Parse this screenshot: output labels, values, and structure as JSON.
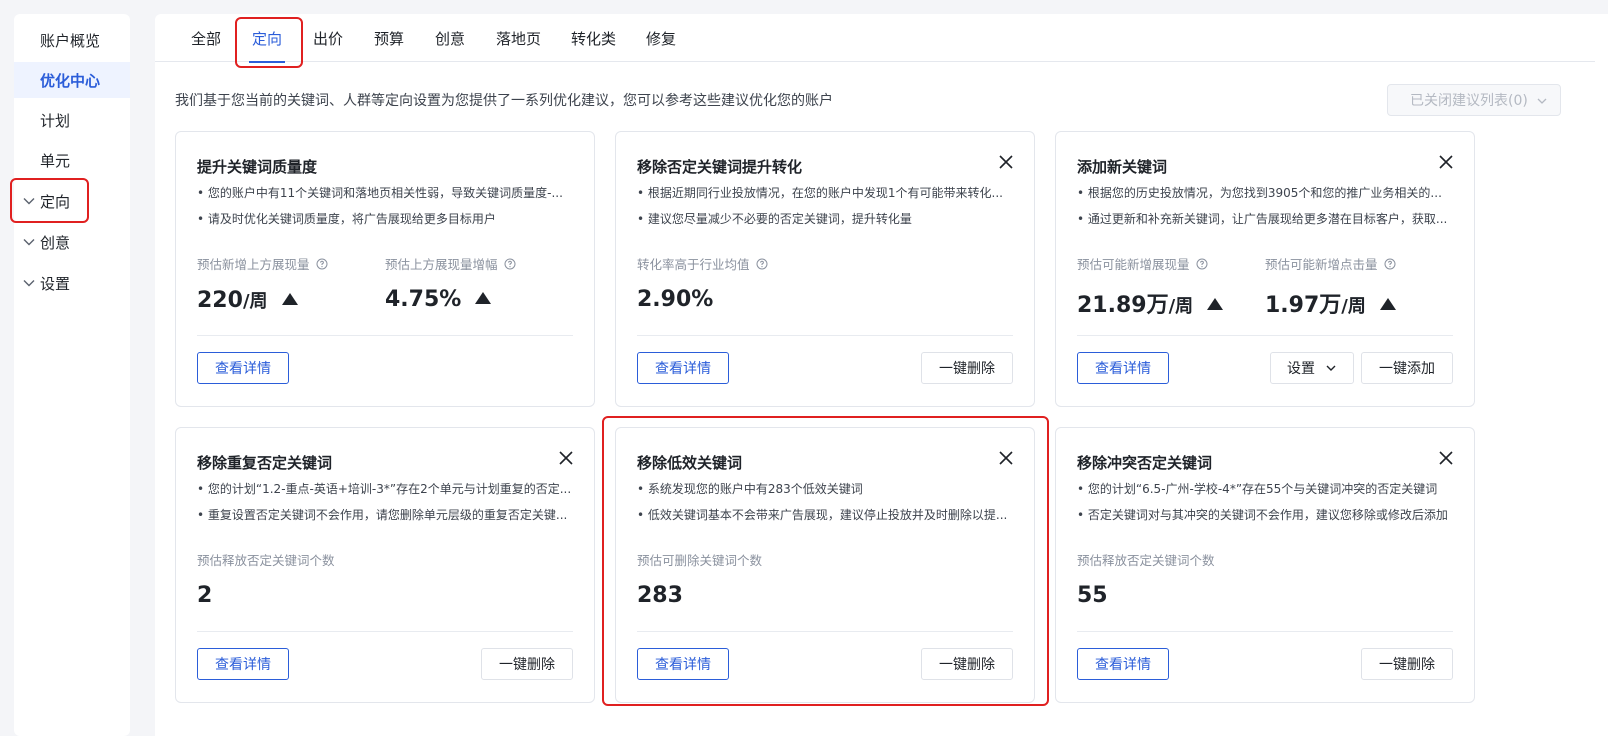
{
  "sidebar": {
    "items": [
      {
        "label": "账户概览"
      },
      {
        "label": "优化中心"
      },
      {
        "label": "计划"
      },
      {
        "label": "单元"
      },
      {
        "label": "定向"
      },
      {
        "label": "创意"
      },
      {
        "label": "设置"
      }
    ]
  },
  "tabs": [
    "全部",
    "定向",
    "出价",
    "预算",
    "创意",
    "落地页",
    "转化类",
    "修复"
  ],
  "active_tab": "定向",
  "intro_text": "我们基于您当前的关键词、人群等定向设置为您提供了一系列优化建议，您可以参考这些建议优化您的账户",
  "closed_list_label": "已关闭建议列表(0)",
  "colors": {
    "accent": "#2b5dd9",
    "highlight": "#e02020"
  },
  "cards": [
    {
      "title": "提升关键词质量度",
      "bullets": [
        "• 您的账户中有11个关键词和落地页相关性弱，导致关键词质量度-...",
        "• 请及时优化关键词质量度，将广告展现给更多目标用户"
      ],
      "metrics": [
        {
          "label": "预估新增上方展现量",
          "value": "220",
          "unit": "/周"
        },
        {
          "label": "预估上方展现量增幅",
          "value": "4.75%",
          "unit": ""
        }
      ],
      "detail_label": "查看详情"
    },
    {
      "title": "移除否定关键词提升转化",
      "bullets": [
        "• 根据近期同行业投放情况，在您的账户中发现1个有可能带来转化...",
        "• 建议您尽量减少不必要的否定关键词，提升转化量"
      ],
      "metrics": [
        {
          "label": "转化率高于行业均值",
          "value": "2.90%",
          "unit": ""
        }
      ],
      "detail_label": "查看详情",
      "action_label": "一键删除"
    },
    {
      "title": "添加新关键词",
      "bullets": [
        "• 根据您的历史投放情况，为您找到3905个和您的推广业务相关的...",
        "• 通过更新和补充新关键词，让广告展现给更多潜在目标客户，获取..."
      ],
      "metrics": [
        {
          "label": "预估可能新增展现量",
          "value": "21.89万",
          "unit": "/周"
        },
        {
          "label": "预估可能新增点击量",
          "value": "1.97万",
          "unit": "/周"
        }
      ],
      "detail_label": "查看详情",
      "settings_label": "设置",
      "action_label": "一键添加"
    },
    {
      "title": "移除重复否定关键词",
      "bullets": [
        "• 您的计划“1.2-重点-英语+培训-3*”存在2个单元与计划重复的否定...",
        "• 重复设置否定关键词不会作用，请您删除单元层级的重复否定关键..."
      ],
      "metrics": [
        {
          "label": "预估释放否定关键词个数",
          "value": "2",
          "unit": ""
        }
      ],
      "detail_label": "查看详情",
      "action_label": "一键删除"
    },
    {
      "title": "移除低效关键词",
      "bullets": [
        "• 系统发现您的账户中有283个低效关键词",
        "• 低效关键词基本不会带来广告展现，建议停止投放并及时删除以提..."
      ],
      "metrics": [
        {
          "label": "预估可删除关键词个数",
          "value": "283",
          "unit": ""
        }
      ],
      "detail_label": "查看详情",
      "action_label": "一键删除"
    },
    {
      "title": "移除冲突否定关键词",
      "bullets": [
        "• 您的计划“6.5-广州-学校-4*”存在55个与关键词冲突的否定关键词",
        "• 否定关键词对与其冲突的关键词不会作用，建议您移除或修改后添加"
      ],
      "metrics": [
        {
          "label": "预估释放否定关键词个数",
          "value": "55",
          "unit": ""
        }
      ],
      "detail_label": "查看详情",
      "action_label": "一键删除"
    }
  ]
}
